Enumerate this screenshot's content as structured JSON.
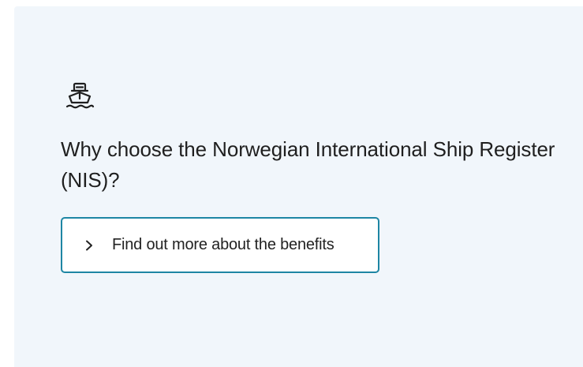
{
  "card": {
    "icon": "ship-icon",
    "heading": "Why choose the Norwegian International Ship Register (NIS)?",
    "link": {
      "icon": "chevron-right-icon",
      "label": "Find out more about the benefits"
    }
  },
  "colors": {
    "card_background": "#f1f6fb",
    "link_border": "#1e86a4",
    "text": "#1f1f1f"
  }
}
